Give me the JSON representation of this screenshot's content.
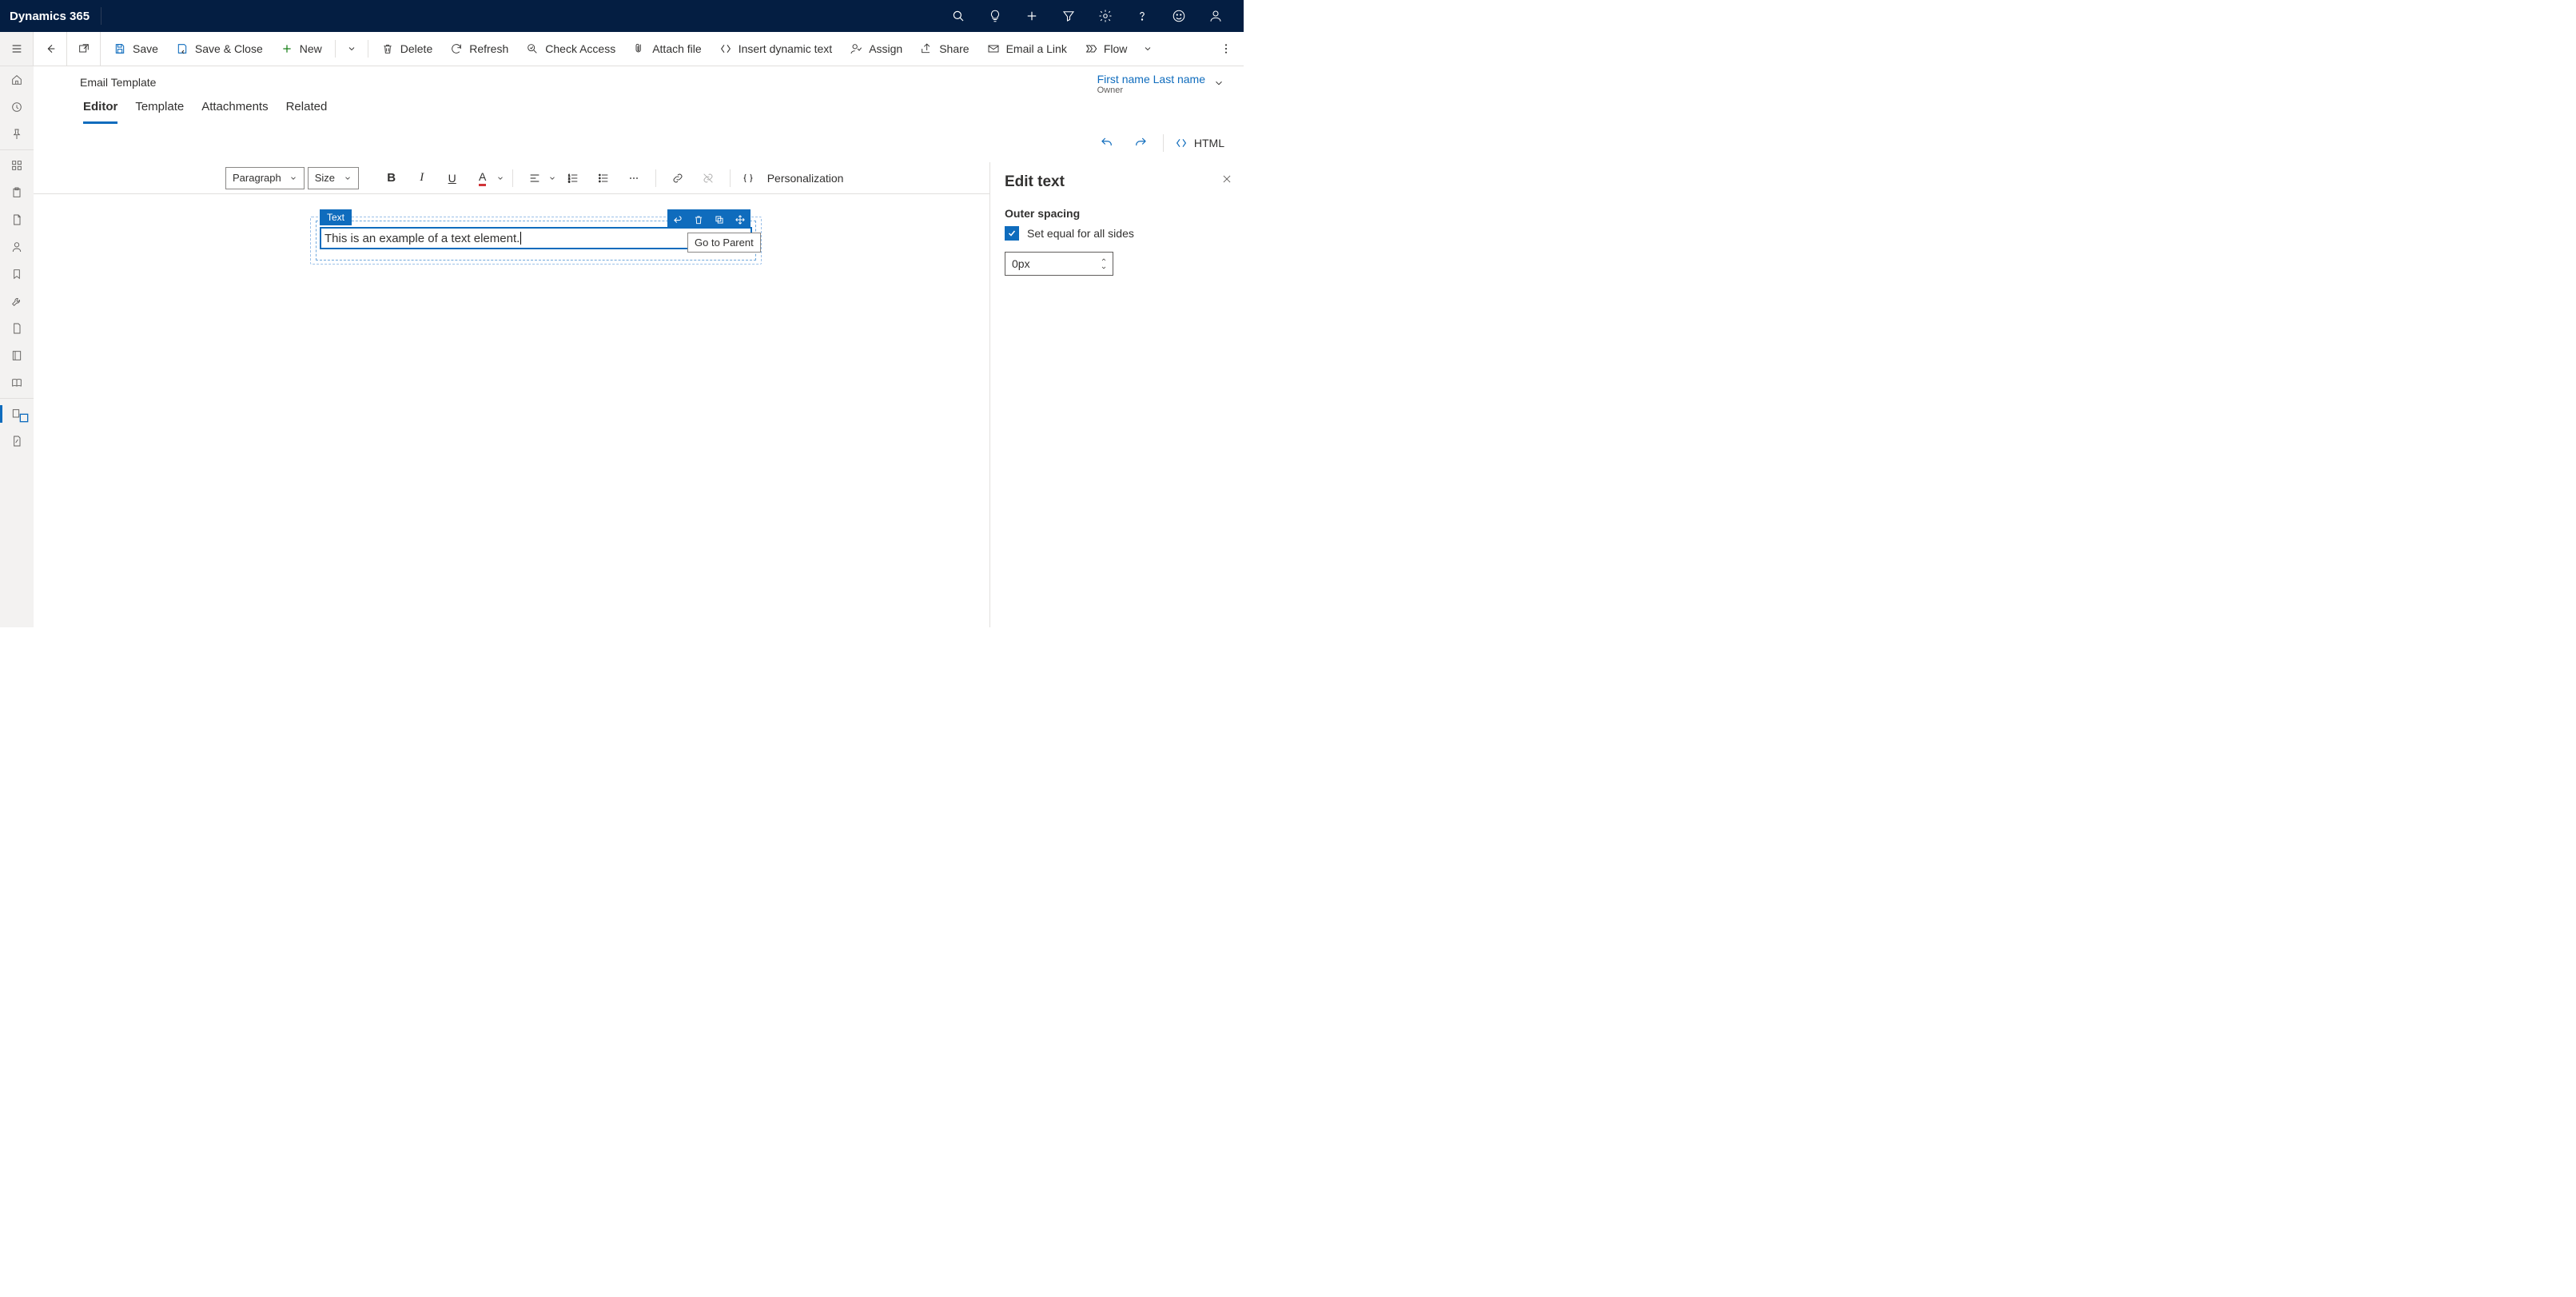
{
  "topbar": {
    "title": "Dynamics 365"
  },
  "commands": {
    "save": "Save",
    "save_close": "Save & Close",
    "new": "New",
    "delete": "Delete",
    "refresh": "Refresh",
    "check_access": "Check Access",
    "attach_file": "Attach file",
    "insert_dynamic_text": "Insert dynamic text",
    "assign": "Assign",
    "share": "Share",
    "email_link": "Email a Link",
    "flow": "Flow"
  },
  "page": {
    "entity_label": "Email Template",
    "owner_name": "First name Last name",
    "owner_role": "Owner"
  },
  "tabs": [
    "Editor",
    "Template",
    "Attachments",
    "Related"
  ],
  "editor_header": {
    "html_btn": "HTML"
  },
  "format_toolbar": {
    "paragraph": "Paragraph",
    "size": "Size",
    "personalization": "Personalization"
  },
  "selection": {
    "label": "Text",
    "content": "This is an example of a text element.",
    "tooltip": "Go to Parent"
  },
  "props": {
    "title": "Edit text",
    "outer_spacing_label": "Outer spacing",
    "equal_sides_label": "Set equal for all sides",
    "spacing_value": "0px"
  }
}
